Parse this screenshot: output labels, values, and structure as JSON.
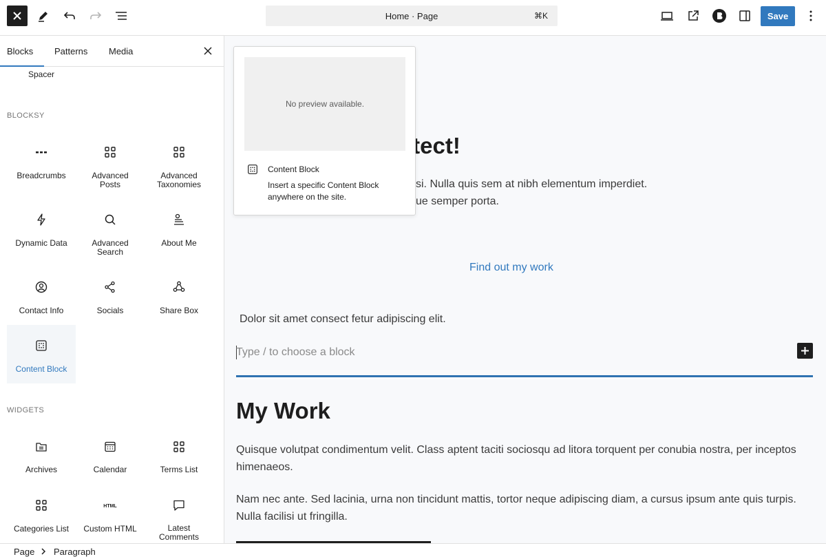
{
  "topbar": {
    "command_title": "Home · Page",
    "command_shortcut": "⌘K",
    "save_label": "Save"
  },
  "sidebar": {
    "tabs": [
      "Blocks",
      "Patterns",
      "Media"
    ],
    "partial_item": "Spacer",
    "blocksy_label": "BLOCKSY",
    "blocksy_items": [
      [
        "Breadcrumbs"
      ],
      [
        "Advanced",
        "Posts"
      ],
      [
        "Advanced",
        "Taxonomies"
      ],
      [
        "Dynamic Data"
      ],
      [
        "Advanced",
        "Search"
      ],
      [
        "About Me"
      ],
      [
        "Contact Info"
      ],
      [
        "Socials"
      ],
      [
        "Share Box"
      ],
      [
        "Content Block"
      ]
    ],
    "widgets_label": "WIDGETS",
    "widget_items": [
      [
        "Archives"
      ],
      [
        "Calendar"
      ],
      [
        "Terms List"
      ],
      [
        "Categories List"
      ],
      [
        "Custom HTML"
      ],
      [
        "Latest",
        "Comments"
      ]
    ]
  },
  "popover": {
    "preview_text": "No preview available.",
    "title": "Content Block",
    "description": "Insert a specific Content Block anywhere on the site."
  },
  "canvas": {
    "hero_partial": "itect!",
    "para1_line1": "si. Nulla quis sem at nibh elementum imperdiet.",
    "para1_line2": "ue semper porta.",
    "link": "Find out my work",
    "dolor": "Dolor sit amet consect fetur adipiscing elit.",
    "placeholder": "Type / to choose a block",
    "heading": "My Work",
    "para2": "Quisque volutpat condimentum velit. Class aptent taciti sociosqu ad litora torquent per conubia nostra, per inceptos himenaeos.",
    "para3": "Nam nec ante. Sed lacinia, urna non tincidunt mattis, tortor neque adipiscing diam, a cursus ipsum ante quis turpis. Nulla facilisi ut fringilla."
  },
  "footer": {
    "breadcrumbs": [
      "Page",
      "Paragraph"
    ]
  },
  "colors": {
    "accent": "#3179be",
    "dark": "#1e1e1e"
  }
}
